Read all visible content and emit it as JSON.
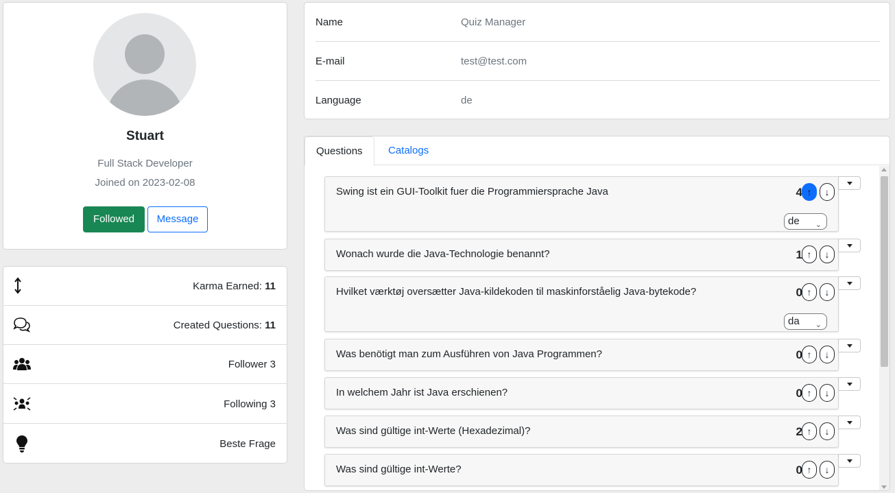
{
  "profile": {
    "name": "Stuart",
    "role": "Full Stack Developer",
    "joined": "Joined on 2023-02-08",
    "followed_label": "Followed",
    "message_label": "Message"
  },
  "stats": [
    {
      "icon": "vertical-arrows-icon",
      "label": "Karma Earned: ",
      "value": "11"
    },
    {
      "icon": "chat-bubbles-icon",
      "label": "Created Questions: ",
      "value": "11"
    },
    {
      "icon": "people-icon",
      "label": "Follower 3",
      "value": ""
    },
    {
      "icon": "people-spread-icon",
      "label": "Following 3",
      "value": ""
    },
    {
      "icon": "lightbulb-icon",
      "label": "Beste Frage",
      "value": ""
    }
  ],
  "info": [
    {
      "label": "Name",
      "value": "Quiz Manager"
    },
    {
      "label": "E-mail",
      "value": "test@test.com"
    },
    {
      "label": "Language",
      "value": "de"
    }
  ],
  "tabs": [
    {
      "label": "Questions",
      "active": true
    },
    {
      "label": "Catalogs",
      "active": false
    }
  ],
  "questions": [
    {
      "text": "Swing ist ein GUI-Toolkit fuer die Programmiersprache Java",
      "score": "4",
      "up_active": true,
      "language": "de"
    },
    {
      "text": "Wonach wurde die Java-Technologie benannt?",
      "score": "1",
      "up_active": false,
      "language": ""
    },
    {
      "text": "Hvilket værktøj oversætter Java-kildekoden til maskinforståelig Java-bytekode?",
      "score": "0",
      "up_active": false,
      "language": "da"
    },
    {
      "text": "Was benötigt man zum Ausführen von Java Programmen?",
      "score": "0",
      "up_active": false,
      "language": ""
    },
    {
      "text": "In welchem Jahr ist Java erschienen?",
      "score": "0",
      "up_active": false,
      "language": ""
    },
    {
      "text": "Was sind gültige int-Werte (Hexadezimal)?",
      "score": "2",
      "up_active": false,
      "language": ""
    },
    {
      "text": "Was sind gültige int-Werte?",
      "score": "0",
      "up_active": false,
      "language": ""
    }
  ],
  "vote_up_glyph": "↑",
  "vote_down_glyph": "↓",
  "colors": {
    "primary": "#0d6efd",
    "success": "#198754",
    "muted": "#6c757d",
    "background": "#ededed"
  }
}
